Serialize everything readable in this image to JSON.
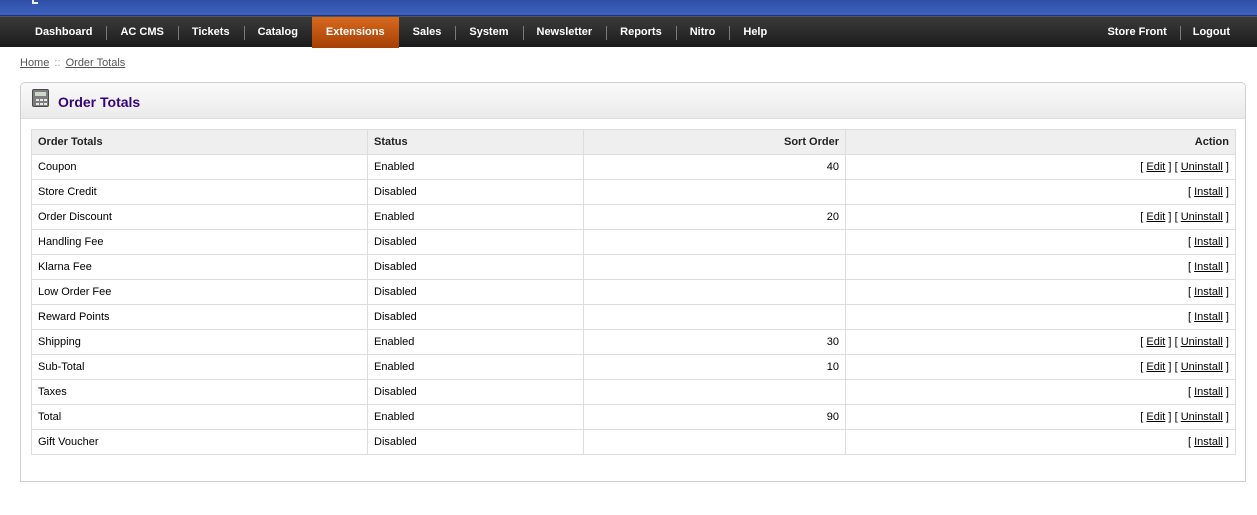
{
  "menu": {
    "items": [
      "Dashboard",
      "AC CMS",
      "Tickets",
      "Catalog",
      "Extensions",
      "Sales",
      "System",
      "Newsletter",
      "Reports",
      "Nitro",
      "Help"
    ],
    "active": "Extensions",
    "right_items": [
      "Store Front",
      "Logout"
    ]
  },
  "breadcrumb": {
    "home": "Home",
    "separator": "::",
    "current": "Order Totals"
  },
  "colors": {
    "active_menu": "#c55410",
    "heading_text": "#33057a",
    "top_bar": "#3a5bb8"
  },
  "box": {
    "icon": "calculator-icon",
    "title": "Order Totals",
    "columns": [
      "Order Totals",
      "Status",
      "Sort Order",
      "Action"
    ],
    "rows": [
      {
        "name": "Coupon",
        "status": "Enabled",
        "sort": "40",
        "actions": [
          "Edit",
          "Uninstall"
        ]
      },
      {
        "name": "Store Credit",
        "status": "Disabled",
        "sort": "",
        "actions": [
          "Install"
        ]
      },
      {
        "name": "Order Discount",
        "status": "Enabled",
        "sort": "20",
        "actions": [
          "Edit",
          "Uninstall"
        ]
      },
      {
        "name": "Handling Fee",
        "status": "Disabled",
        "sort": "",
        "actions": [
          "Install"
        ]
      },
      {
        "name": "Klarna Fee",
        "status": "Disabled",
        "sort": "",
        "actions": [
          "Install"
        ]
      },
      {
        "name": "Low Order Fee",
        "status": "Disabled",
        "sort": "",
        "actions": [
          "Install"
        ]
      },
      {
        "name": "Reward Points",
        "status": "Disabled",
        "sort": "",
        "actions": [
          "Install"
        ]
      },
      {
        "name": "Shipping",
        "status": "Enabled",
        "sort": "30",
        "actions": [
          "Edit",
          "Uninstall"
        ]
      },
      {
        "name": "Sub-Total",
        "status": "Enabled",
        "sort": "10",
        "actions": [
          "Edit",
          "Uninstall"
        ]
      },
      {
        "name": "Taxes",
        "status": "Disabled",
        "sort": "",
        "actions": [
          "Install"
        ]
      },
      {
        "name": "Total",
        "status": "Enabled",
        "sort": "90",
        "actions": [
          "Edit",
          "Uninstall"
        ]
      },
      {
        "name": "Gift Voucher",
        "status": "Disabled",
        "sort": "",
        "actions": [
          "Install"
        ]
      }
    ]
  }
}
